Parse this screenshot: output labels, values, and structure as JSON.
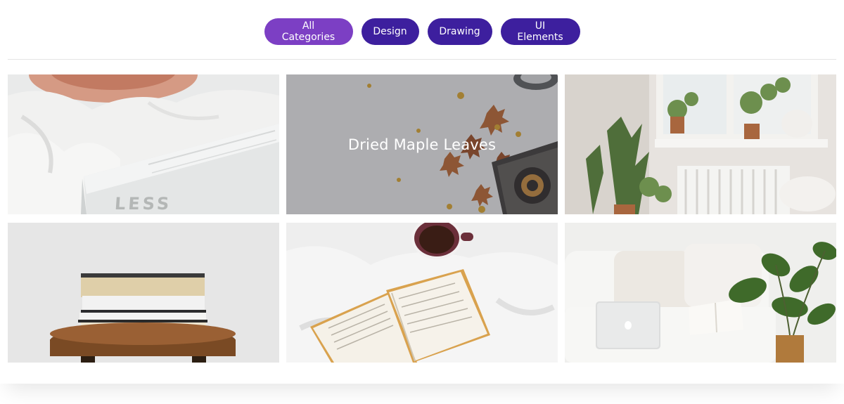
{
  "filters": [
    {
      "label": "All Categories",
      "active": true
    },
    {
      "label": "Design",
      "active": false
    },
    {
      "label": "Drawing",
      "active": false
    },
    {
      "label": "UI Elements",
      "active": false
    }
  ],
  "gallery": {
    "hover_title": "Dried Maple Leaves",
    "book_cover_text": "LESS"
  },
  "colors": {
    "active_chip": "#7c3fc4",
    "chip": "#3d1f9e"
  }
}
